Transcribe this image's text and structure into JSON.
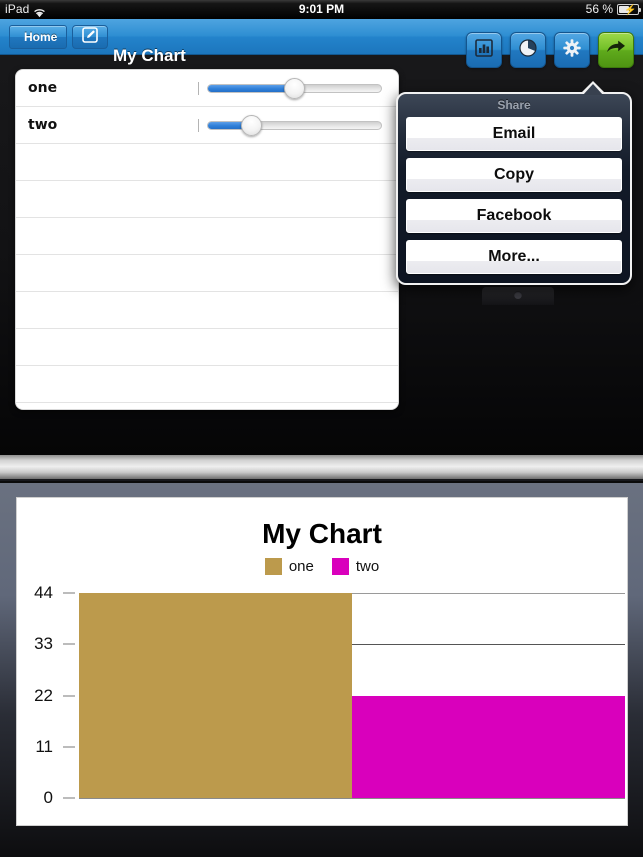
{
  "status_bar": {
    "device_label": "iPad",
    "wifi_icon": "wifi-icon",
    "time": "9:01 PM",
    "battery_percent": "56 %",
    "battery_icon": "battery-charging-icon"
  },
  "nav_bar": {
    "back_label": "Home",
    "edit_icon": "compose-icon",
    "title": "My Chart",
    "tools": [
      {
        "name": "bar-chart-button",
        "icon": "bar-chart-icon"
      },
      {
        "name": "pie-chart-button",
        "icon": "pie-chart-icon"
      },
      {
        "name": "settings-button",
        "icon": "gear-icon"
      },
      {
        "name": "share-button",
        "icon": "share-arrow-icon"
      }
    ]
  },
  "data_table": {
    "rows": [
      {
        "label": "one",
        "slider_percent": 50
      },
      {
        "label": "two",
        "slider_percent": 25
      }
    ],
    "empty_row_count": 8
  },
  "popover": {
    "title": "Share",
    "items": [
      {
        "label": "Email"
      },
      {
        "label": "Copy"
      },
      {
        "label": "Facebook"
      },
      {
        "label": "More..."
      }
    ]
  },
  "chart_data": {
    "type": "bar",
    "title": "My Chart",
    "categories": [
      "one",
      "two"
    ],
    "series": [
      {
        "name": "one",
        "values": [
          44
        ],
        "color": "#bc9a4c"
      },
      {
        "name": "two",
        "values": [
          22
        ],
        "color": "#d900bc"
      }
    ],
    "values": [
      44,
      22
    ],
    "colors": [
      "#bc9a4c",
      "#d900bc"
    ],
    "legend": [
      "one",
      "two"
    ],
    "legend_position": "top",
    "xlabel": "",
    "ylabel": "",
    "yticks": [
      0,
      11,
      22,
      33,
      44
    ],
    "ylim": [
      0,
      44
    ],
    "grid": true
  }
}
